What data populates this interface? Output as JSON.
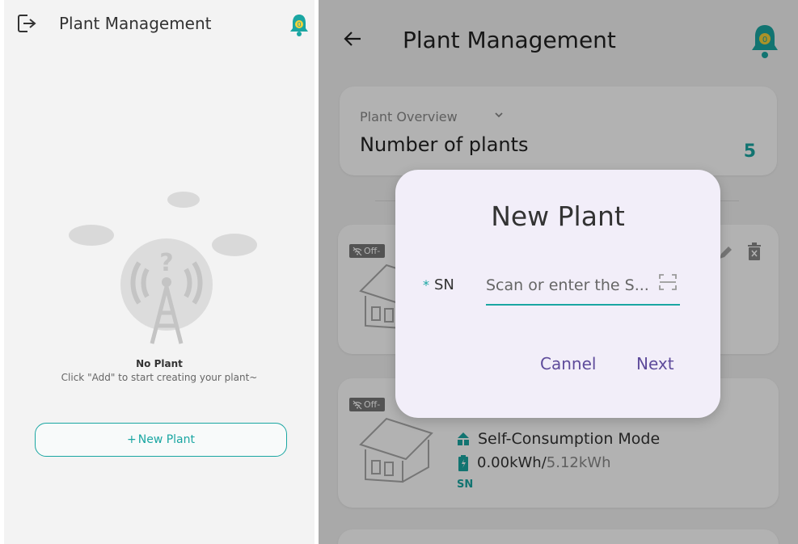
{
  "left_screen": {
    "header": {
      "title": "Plant Management",
      "notification_count": "0"
    },
    "empty_state": {
      "title": "No Plant",
      "subtitle": "Click \"Add\" to start creating your plant~"
    },
    "new_plant_button": {
      "plus": "+",
      "label": "New Plant"
    }
  },
  "right_screen": {
    "header": {
      "title": "Plant Management",
      "notification_count": "0"
    },
    "overview": {
      "label": "Plant Overview",
      "number_label": "Number of plants",
      "count": "5"
    },
    "plants": [
      {
        "status": "Off-"
      },
      {
        "status": "Off-",
        "mode": "Self-Consumption Mode",
        "energy_used": "0.00kWh",
        "energy_sep": "/",
        "energy_total": "5.12kWh",
        "sn_label": "SN"
      }
    ],
    "dialog": {
      "title": "New Plant",
      "required_mark": "*",
      "sn_label": "SN",
      "sn_placeholder": "Scan or enter the S...",
      "sn_value": "",
      "cancel_label": "Cannel",
      "next_label": "Next"
    }
  },
  "colors": {
    "accent": "#1aa6a2",
    "dialog_bg": "#f2eef9",
    "dialog_button": "#5e4b9b"
  },
  "icons": [
    "logout-icon",
    "bell-icon",
    "back-arrow-icon",
    "chevron-down-icon",
    "edit-icon",
    "delete-icon",
    "offline-icon",
    "house-icon",
    "mode-icon",
    "battery-icon",
    "scan-icon"
  ]
}
